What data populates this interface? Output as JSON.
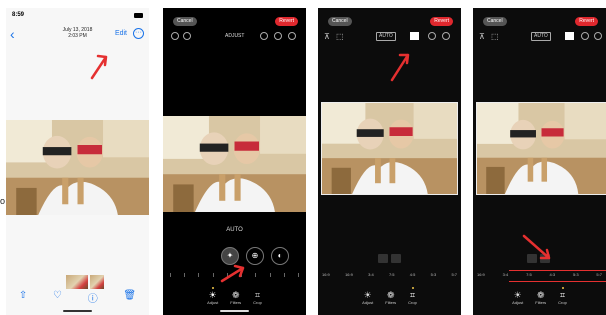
{
  "phone1": {
    "status_time": "8:59",
    "date_line1": "July 13, 2018",
    "date_line2": "2:03 PM",
    "back_glyph": "‹",
    "edit_label": "Edit",
    "more_glyph": "···",
    "toolbar": [
      {
        "icon": "share-icon",
        "glyph": "⇧"
      },
      {
        "icon": "heart-icon",
        "glyph": "♡"
      },
      {
        "icon": "info-icon",
        "glyph": "ⓘ"
      },
      {
        "icon": "trash-icon",
        "glyph": "🗑"
      }
    ]
  },
  "phone2": {
    "cancel": "Cancel",
    "revert": "Revert",
    "title": "ADJUST",
    "auto_label": "AUTO",
    "tools": [
      {
        "icon": "magic-wand-icon",
        "glyph": "✦"
      },
      {
        "icon": "exposure-icon",
        "glyph": "⊕"
      },
      {
        "icon": "brilliance-icon",
        "glyph": "◐"
      }
    ],
    "tabs": [
      {
        "icon": "adjust-icon",
        "glyph": "☀",
        "label": "Adjust"
      },
      {
        "icon": "filters-icon",
        "glyph": "❁",
        "label": "Filters"
      },
      {
        "icon": "crop-icon",
        "glyph": "⌗",
        "label": "Crop"
      }
    ]
  },
  "phone3": {
    "cancel": "Cancel",
    "revert": "Revert",
    "auto_label": "AUTO",
    "scale_labels": [
      "16:9",
      "16:9",
      "3:4",
      "7:5",
      "4:5",
      "5:3",
      "5:7"
    ],
    "tabs": [
      {
        "icon": "adjust-icon",
        "glyph": "☀",
        "label": "Adjust"
      },
      {
        "icon": "filters-icon",
        "glyph": "❁",
        "label": "Filters"
      },
      {
        "icon": "crop-icon",
        "glyph": "⌗",
        "label": "Crop"
      }
    ]
  },
  "phone4": {
    "cancel": "Cancel",
    "revert": "Revert",
    "auto_label": "AUTO",
    "scale_labels": [
      "16:9",
      "3:4",
      "7:5",
      "4:3",
      "5:3",
      "5:7"
    ],
    "tabs": [
      {
        "icon": "adjust-icon",
        "glyph": "☀",
        "label": "Adjust"
      },
      {
        "icon": "filters-icon",
        "glyph": "❁",
        "label": "Filters"
      },
      {
        "icon": "crop-icon",
        "glyph": "⌗",
        "label": "Crop"
      }
    ]
  },
  "edge_letter": "o",
  "colors": {
    "accent_blue": "#1a73e8",
    "revert_red": "#e0282e",
    "annotation_red": "#e53030",
    "dark_bg": "#0c0c0c"
  }
}
